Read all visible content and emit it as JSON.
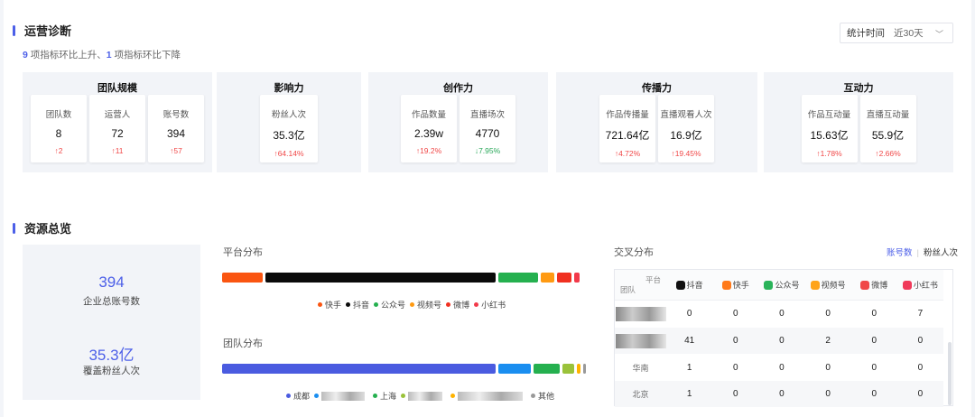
{
  "diagnosis": {
    "title": "运营诊断",
    "summary": {
      "up_count": "9",
      "up_text": " 项指标环比上升、",
      "down_count": "1",
      "down_text": " 项指标环比下降"
    },
    "time": {
      "label": "统计时间",
      "value": "近30天"
    },
    "groups": [
      {
        "title": "团队规模",
        "cards": [
          {
            "label": "团队数",
            "value": "8",
            "change": "2",
            "dir": "up"
          },
          {
            "label": "运营人",
            "value": "72",
            "change": "11",
            "dir": "up"
          },
          {
            "label": "账号数",
            "value": "394",
            "change": "57",
            "dir": "up"
          }
        ]
      },
      {
        "title": "影响力",
        "cards": [
          {
            "label": "粉丝人次",
            "value": "35.3亿",
            "change": "64.14%",
            "dir": "up"
          }
        ]
      },
      {
        "title": "创作力",
        "cards": [
          {
            "label": "作品数量",
            "value": "2.39w",
            "change": "19.2%",
            "dir": "up"
          },
          {
            "label": "直播场次",
            "value": "4770",
            "change": "7.95%",
            "dir": "down"
          }
        ]
      },
      {
        "title": "传播力",
        "cards": [
          {
            "label": "作品传播量",
            "value": "721.64亿",
            "change": "4.72%",
            "dir": "up"
          },
          {
            "label": "直播观看人次",
            "value": "16.9亿",
            "change": "19.45%",
            "dir": "up"
          }
        ]
      },
      {
        "title": "互动力",
        "cards": [
          {
            "label": "作品互动量",
            "value": "15.63亿",
            "change": "1.78%",
            "dir": "up"
          },
          {
            "label": "直播互动量",
            "value": "55.9亿",
            "change": "2.66%",
            "dir": "up"
          }
        ]
      }
    ]
  },
  "resources": {
    "title": "资源总览",
    "stats": [
      {
        "value": "394",
        "label": "企业总账号数"
      },
      {
        "value": "35.3亿",
        "label": "覆盖粉丝人次"
      }
    ],
    "platform_dist": {
      "title": "平台分布",
      "segments": [
        {
          "name": "快手",
          "share": 0.115,
          "color": "#fa5511"
        },
        {
          "name": "抖音",
          "share": 0.65,
          "color": "#0a0a0a"
        },
        {
          "name": "公众号",
          "share": 0.112,
          "color": "#25b04f"
        },
        {
          "name": "视频号",
          "share": 0.037,
          "color": "#ff9a12"
        },
        {
          "name": "微博",
          "share": 0.04,
          "color": "#f03020"
        },
        {
          "name": "小红书",
          "share": 0.016,
          "color": "#f23a4a"
        }
      ]
    },
    "team_dist": {
      "title": "团队分布",
      "segments": [
        {
          "name": "成都",
          "share": 0.772,
          "color": "#4a5be0"
        },
        {
          "name": "",
          "share": 0.093,
          "color": "#1a8ef0"
        },
        {
          "name": "上海",
          "share": 0.075,
          "color": "#25b04f"
        },
        {
          "name": "",
          "share": 0.032,
          "color": "#9ac23a"
        },
        {
          "name": "",
          "share": 0.01,
          "color": "#ffb300"
        },
        {
          "name": "其他",
          "share": 0.008,
          "color": "#999999"
        }
      ]
    },
    "cross": {
      "title": "交叉分布",
      "toggle": {
        "a": "账号数",
        "b": "粉丝人次"
      },
      "corner": {
        "platform": "平台",
        "team": "团队"
      },
      "columns": [
        {
          "name": "抖音",
          "color": "#111111",
          "icon": "douyin-icon"
        },
        {
          "name": "快手",
          "color": "#ff7a1a",
          "icon": "kuaishou-icon"
        },
        {
          "name": "公众号",
          "color": "#2ab35a",
          "icon": "wechat-icon"
        },
        {
          "name": "视频号",
          "color": "#ffa318",
          "icon": "channels-icon"
        },
        {
          "name": "微博",
          "color": "#f04848",
          "icon": "weibo-icon"
        },
        {
          "name": "小红书",
          "color": "#f03a5a",
          "icon": "xiaohongshu-icon"
        }
      ],
      "rows": [
        {
          "team": "",
          "values": [
            "0",
            "0",
            "0",
            "0",
            "0",
            "7"
          ]
        },
        {
          "team": "",
          "values": [
            "41",
            "0",
            "0",
            "2",
            "0",
            "0"
          ]
        },
        {
          "team": "华南",
          "values": [
            "1",
            "0",
            "0",
            "0",
            "0",
            "0"
          ]
        },
        {
          "team": "北京",
          "values": [
            "1",
            "0",
            "0",
            "0",
            "0",
            "0"
          ]
        }
      ]
    }
  }
}
